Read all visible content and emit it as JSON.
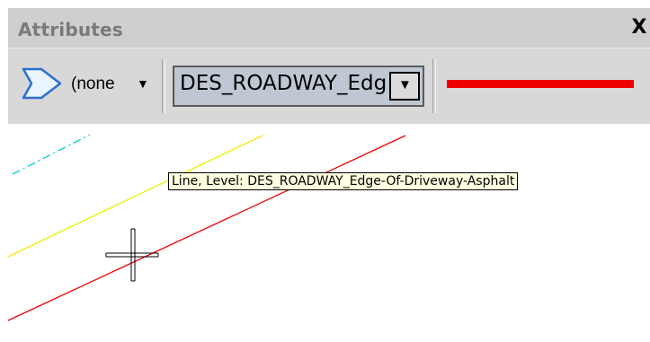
{
  "toolbar": {
    "title": "Attributes",
    "close_glyph": "X",
    "element_type": {
      "icon": "shape-icon",
      "label": "(none",
      "arrow": "▼"
    },
    "level": {
      "value": "DES_ROADWAY_Edg",
      "arrow": "▼"
    },
    "line_color": "#ee0000"
  },
  "canvas": {
    "background": "#ffffff",
    "lines": [
      {
        "color": "#00ccdd",
        "style": "dash-dot"
      },
      {
        "color": "#eeee00",
        "style": "solid"
      },
      {
        "color": "#ee0000",
        "style": "solid"
      }
    ],
    "cursor": "crosshair-cursor"
  },
  "tooltip": {
    "text": "Line, Level: DES_ROADWAY_Edge-Of-Driveway-Asphalt"
  }
}
